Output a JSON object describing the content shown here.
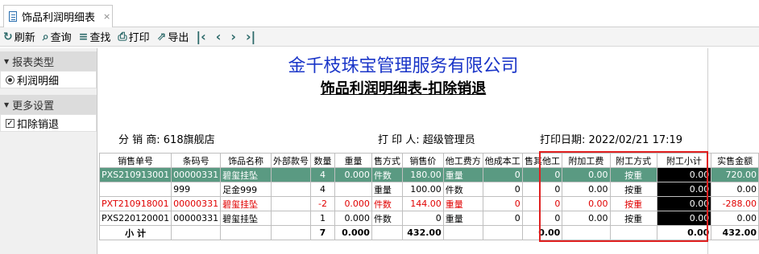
{
  "tab": {
    "title": "饰品利润明细表",
    "close": "×"
  },
  "toolbar": {
    "refresh": "刷新",
    "query": "查询",
    "find": "查找",
    "print": "打印",
    "export": "导出"
  },
  "sidebar": {
    "section1": "报表类型",
    "option1": "利润明细",
    "section2": "更多设置",
    "option2": "扣除销退"
  },
  "report": {
    "company": "金千枝珠宝管理服务有限公司",
    "title": "饰品利润明细表-扣除销退",
    "distributor": "分 销 商: 618旗舰店",
    "printer": "打 印 人: 超级管理员",
    "print_date": "打印日期: 2022/02/21 17:19"
  },
  "table": {
    "headers": [
      "销售单号",
      "条码号",
      "饰品名称",
      "外部款号",
      "数量",
      "重量",
      "售方式",
      "销售价",
      "他工费方",
      "他成本工",
      "售其他工",
      "附加工费",
      "附工方式",
      "附工小计",
      "实售金额"
    ],
    "rows": [
      [
        "PXS210913001",
        "00000331",
        "碧玺挂坠",
        "",
        "4",
        "0.000",
        "件数",
        "180.00",
        "重量",
        "0",
        "0",
        "0.00",
        "按重",
        "0.00",
        "720.00"
      ],
      [
        "",
        "999",
        "足金999",
        "",
        "4",
        "",
        "重量",
        "100.00",
        "件数",
        "0",
        "0",
        "0.00",
        "按重",
        "0.00",
        "0.00"
      ],
      [
        "PXT210918001",
        "00000331",
        "碧玺挂坠",
        "",
        "-2",
        "0.000",
        "件数",
        "144.00",
        "重量",
        "0",
        "0",
        "0.00",
        "按重",
        "0.00",
        "-288.00"
      ],
      [
        "PXS220120001",
        "00000331",
        "碧玺挂坠",
        "",
        "1",
        "0.000",
        "件数",
        "0",
        "重量",
        "0",
        "0",
        "0.00",
        "按重",
        "0.00",
        "0.00"
      ]
    ],
    "summary": [
      "小 计",
      "",
      "",
      "",
      "7",
      "0.000",
      "",
      "432.00",
      "",
      "",
      "0.00",
      "",
      "",
      "0.00",
      "432.00"
    ]
  }
}
